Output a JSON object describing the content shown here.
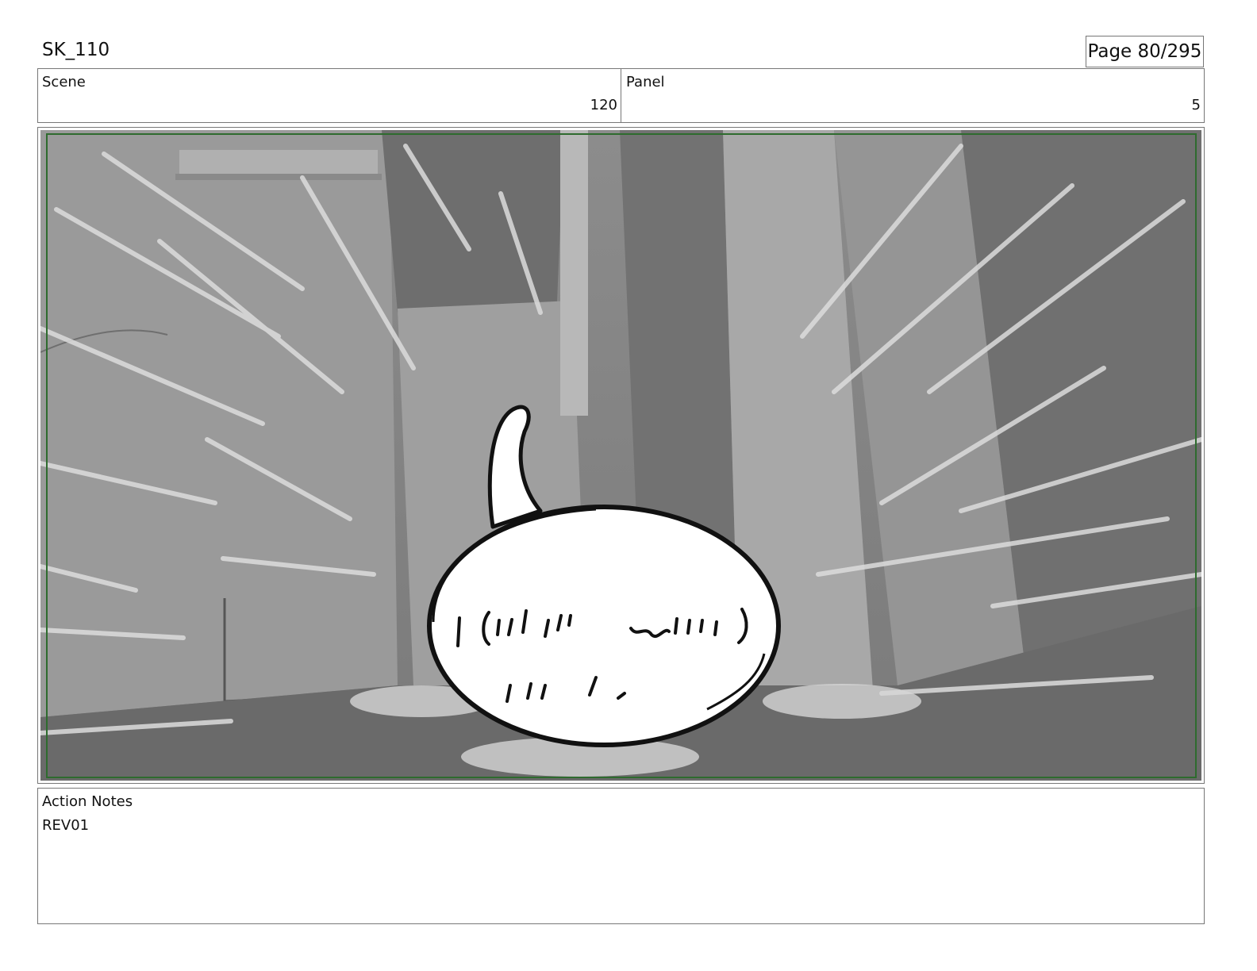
{
  "document": {
    "title": "SK_110",
    "page": "Page 80/295"
  },
  "header": {
    "scene_label": "Scene",
    "scene_value": "120",
    "panel_label": "Panel",
    "panel_value": "5"
  },
  "notes": {
    "label": "Action Notes",
    "text": "REV01"
  },
  "colors": {
    "frame_border": "#777777",
    "safe_area": "#2e6b2e",
    "bubble_fill": "#ffffff",
    "ink": "#111111"
  }
}
